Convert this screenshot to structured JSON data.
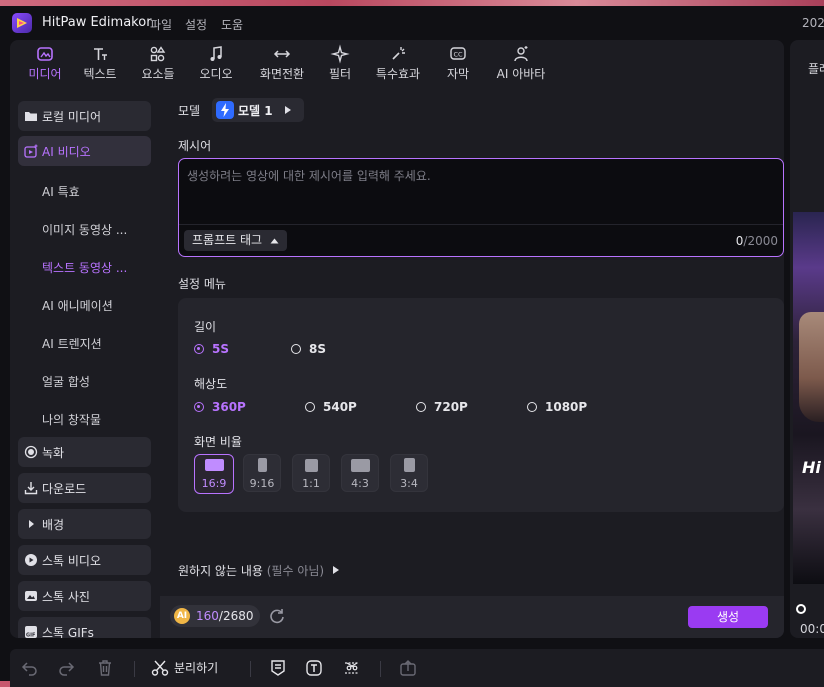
{
  "app": {
    "title": "HitPaw Edimakor",
    "menu": [
      "파일",
      "설정",
      "도움"
    ],
    "clock": "202"
  },
  "tabs": [
    {
      "label": "미디어",
      "icon": "media-icon",
      "active": true
    },
    {
      "label": "텍스트",
      "icon": "text-icon"
    },
    {
      "label": "요소들",
      "icon": "elements-icon"
    },
    {
      "label": "오디오",
      "icon": "audio-icon"
    },
    {
      "label": "화면전환",
      "icon": "transition-icon"
    },
    {
      "label": "필터",
      "icon": "filter-icon"
    },
    {
      "label": "특수효과",
      "icon": "effects-icon"
    },
    {
      "label": "자막",
      "icon": "subtitle-icon"
    },
    {
      "label": "AI 아바타",
      "icon": "ai-avatar-icon"
    }
  ],
  "sidebar": {
    "local_media": "로컬 미디어",
    "ai_video": "AI 비디오",
    "sub": [
      "AI 특효",
      "이미지 동영상 ...",
      "텍스트 동영상 ...",
      "AI 애니메이션",
      "AI 트렌지션",
      "얼굴 합성",
      "나의 창작물"
    ],
    "record": "녹화",
    "download": "다운로드",
    "background": "배경",
    "stock_video": "스톡 비디오",
    "stock_photo": "스톡 사진",
    "stock_gifs": "스톡 GIFs"
  },
  "content": {
    "model_label": "모델",
    "model_value": "모델 1",
    "prompt_label": "제시어",
    "prompt_placeholder": "생성하려는 영상에 대한 제시어를 입력해 주세요.",
    "prompt_tag_button": "프롬프트 태그",
    "char_count": "0",
    "char_max": "/2000",
    "settings_menu_label": "설정 메뉴",
    "length": {
      "label": "길이",
      "options": [
        "5S",
        "8S"
      ],
      "selected": "5S"
    },
    "resolution": {
      "label": "해상도",
      "options": [
        "360P",
        "540P",
        "720P",
        "1080P"
      ],
      "selected": "360P"
    },
    "aspect": {
      "label": "화면 비율",
      "options": [
        "16:9",
        "9:16",
        "1:1",
        "4:3",
        "3:4"
      ],
      "selected": "16:9"
    },
    "negative_label": "원하지 않는 내용",
    "negative_optional": "(필수 아님)"
  },
  "footer": {
    "credits_used": "160",
    "credits_total": "/2680",
    "generate_button": "생성"
  },
  "preview": {
    "tab_label": "플레",
    "time": "00:0",
    "overlay_text": "Hi"
  },
  "toolbar": {
    "split_label": "분리하기"
  },
  "colors": {
    "accent": "#b873ff",
    "generate": "#9a3bf2",
    "panel": "#1c1c22"
  }
}
